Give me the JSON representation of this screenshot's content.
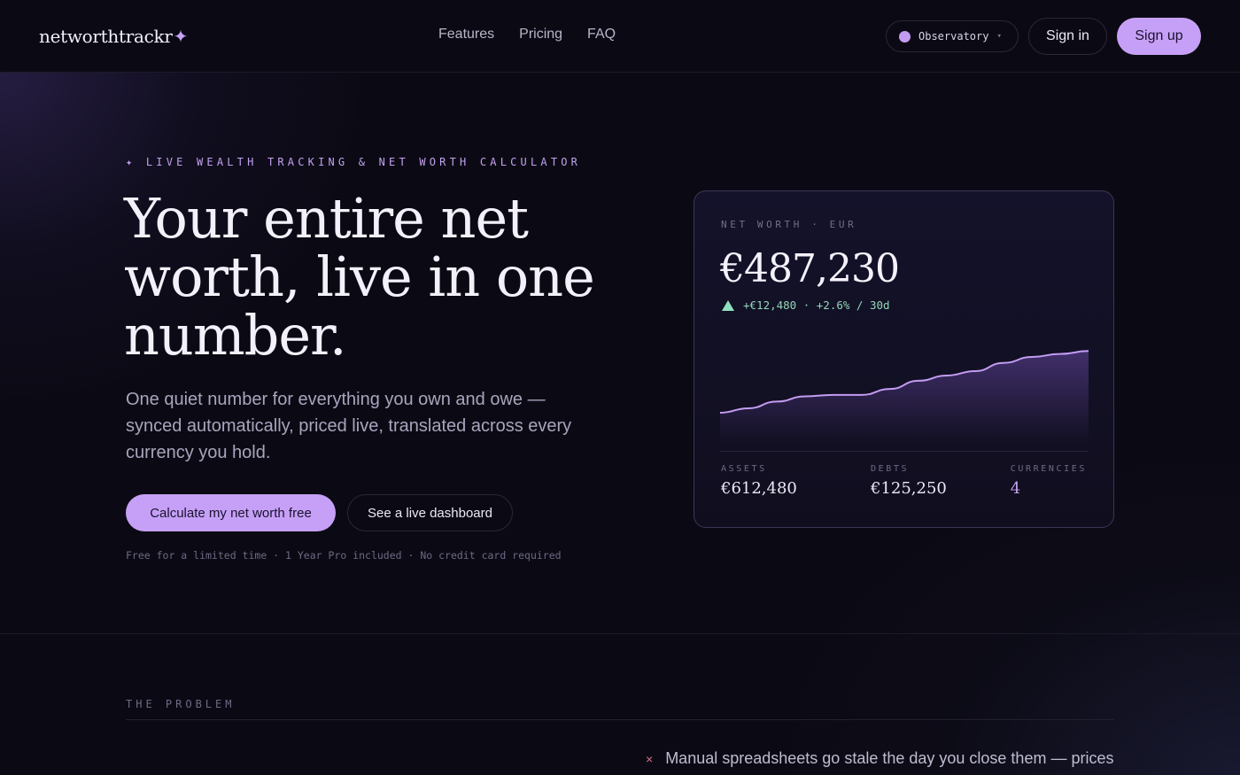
{
  "nav": {
    "logo": "networthtrackr",
    "logo_mark": "✦",
    "links": [
      "Features",
      "Pricing",
      "FAQ"
    ],
    "theme_label": "Observatory",
    "theme_caret": "▾",
    "sign_in": "Sign in",
    "sign_up": "Sign up"
  },
  "hero": {
    "eyebrow": "✦ LIVE WEALTH TRACKING & NET WORTH CALCULATOR",
    "headline": "Your entire net worth, live in one number.",
    "subcopy": "One quiet number for everything you own and owe — synced automatically, priced live, translated across every currency you hold.",
    "cta_primary": "Calculate my net worth free",
    "cta_secondary": "See a live dashboard",
    "fineprint": "Free for a limited time · 1 Year Pro included · No credit card required"
  },
  "card": {
    "label": "NET WORTH · EUR",
    "value": "€487,230",
    "change": "+€12,480 · +2.6% / 30d",
    "stats": {
      "assets_label": "ASSETS",
      "assets_value": "€612,480",
      "debts_label": "DEBTS",
      "debts_value": "€125,250",
      "currencies_label": "CURRENCIES",
      "currencies_value": "4"
    },
    "sparkline": [
      0.0,
      0.06,
      0.15,
      0.22,
      0.24,
      0.24,
      0.32,
      0.43,
      0.5,
      0.56,
      0.67,
      0.75,
      0.79,
      0.83
    ],
    "colors": {
      "line": "#c39cf2",
      "up": "#93d6b8"
    }
  },
  "problem": {
    "label": "THE PROBLEM",
    "first_item": "Manual spreadsheets go stale the day you close them — prices",
    "bullet": "×"
  },
  "colors": {
    "accent": "#c6a0f6",
    "background": "#0b0a14"
  }
}
